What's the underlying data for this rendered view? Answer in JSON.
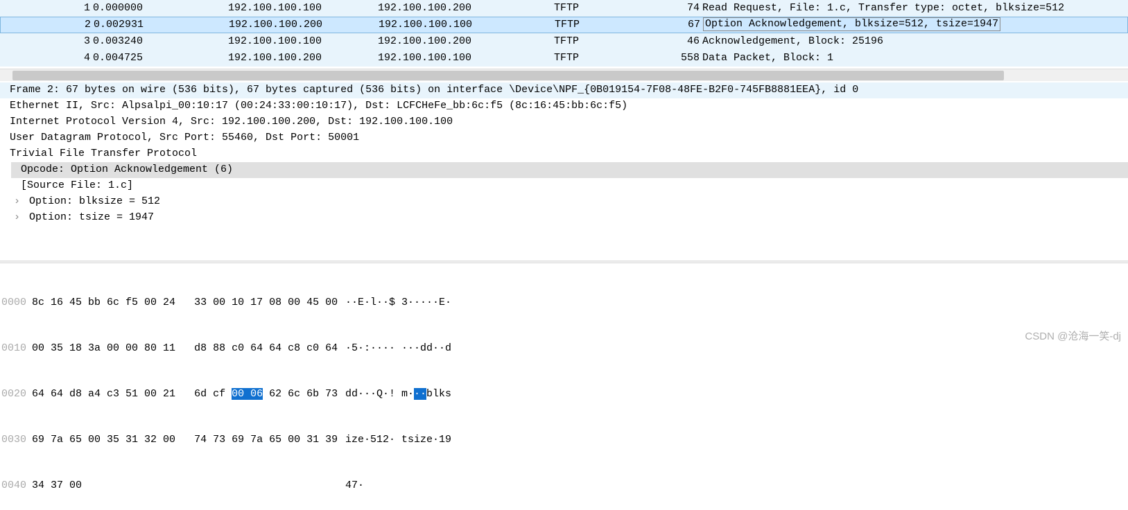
{
  "packet_list": {
    "rows": [
      {
        "no": "1",
        "time": "0.000000",
        "src": "192.100.100.100",
        "dst": "192.100.100.200",
        "proto": "TFTP",
        "len": "74",
        "info": "Read Request, File: 1.c, Transfer type: octet, blksize=512"
      },
      {
        "no": "2",
        "time": "0.002931",
        "src": "192.100.100.200",
        "dst": "192.100.100.100",
        "proto": "TFTP",
        "len": "67",
        "info": "Option Acknowledgement, blksize=512, tsize=1947"
      },
      {
        "no": "3",
        "time": "0.003240",
        "src": "192.100.100.100",
        "dst": "192.100.100.200",
        "proto": "TFTP",
        "len": "46",
        "info": "Acknowledgement, Block: 25196"
      },
      {
        "no": "4",
        "time": "0.004725",
        "src": "192.100.100.200",
        "dst": "192.100.100.100",
        "proto": "TFTP",
        "len": "558",
        "info": "Data Packet, Block: 1"
      }
    ]
  },
  "details": {
    "frame": "Frame 2: 67 bytes on wire (536 bits), 67 bytes captured (536 bits) on interface \\Device\\NPF_{0B019154-7F08-48FE-B2F0-745FB8881EEA}, id 0",
    "eth": "Ethernet II, Src: Alpsalpi_00:10:17 (00:24:33:00:10:17), Dst: LCFCHeFe_bb:6c:f5 (8c:16:45:bb:6c:f5)",
    "ip": "Internet Protocol Version 4, Src: 192.100.100.200, Dst: 192.100.100.100",
    "udp": "User Datagram Protocol, Src Port: 55460, Dst Port: 50001",
    "tftp": "Trivial File Transfer Protocol",
    "opcode": "Opcode: Option Acknowledgement (6)",
    "srcfile": "[Source File: 1.c]",
    "opt1": "Option: blksize = 512",
    "opt2": "Option: tsize = 1947"
  },
  "hex": {
    "rows": [
      {
        "off": "0000",
        "b1": "8c 16 45 bb 6c f5 00 24",
        "b2": "33 00 10 17 08 00 45 00",
        "a": "··E·l··$ 3·····E·"
      },
      {
        "off": "0010",
        "b1": "00 35 18 3a 00 00 80 11",
        "b2": "d8 88 c0 64 64 c8 c0 64",
        "a": "·5·:···· ···dd··d"
      },
      {
        "off": "0020",
        "b1": "64 64 d8 a4 c3 51 00 21",
        "b2_pre": "6d cf ",
        "b2_sel": "00 06",
        "b2_post": " 62 6c 6b 73",
        "a_pre": "dd···Q·! m·",
        "a_sel": "··",
        "a_post": "blks"
      },
      {
        "off": "0030",
        "b1": "69 7a 65 00 35 31 32 00",
        "b2": "74 73 69 7a 65 00 31 39",
        "a": "ize·512· tsize·19"
      },
      {
        "off": "0040",
        "b1": "34 37 00",
        "b2": "",
        "a": "47·"
      }
    ]
  },
  "watermark": "CSDN @沧海一笑-dj"
}
